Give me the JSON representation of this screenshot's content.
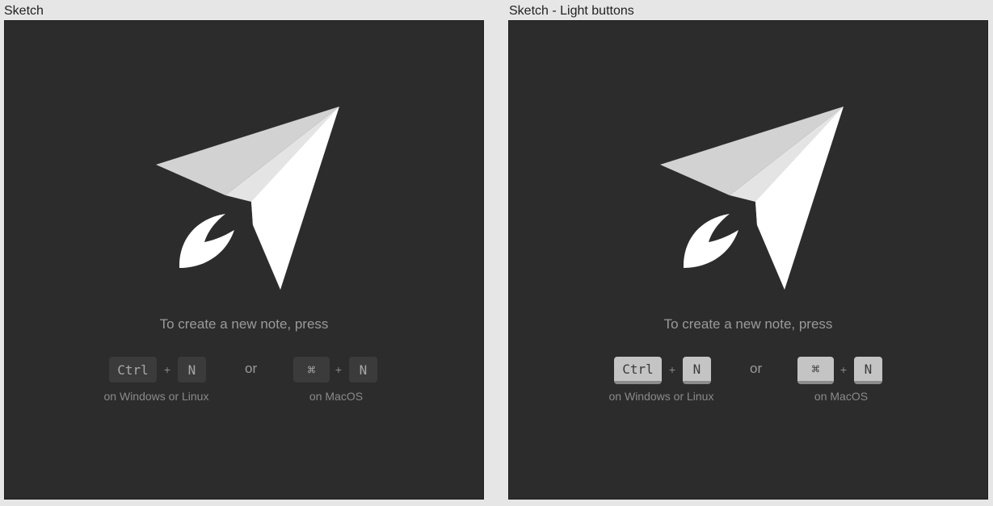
{
  "frames": [
    {
      "title": "Sketch",
      "variant": "dark",
      "prompt": "To create a new note, press",
      "windows": {
        "key1": "Ctrl",
        "plus": "+",
        "key2": "N",
        "caption": "on Windows or Linux"
      },
      "separator": "or",
      "mac": {
        "key1": "⌘",
        "plus": "+",
        "key2": "N",
        "caption": "on MacOS"
      }
    },
    {
      "title": "Sketch - Light buttons",
      "variant": "light",
      "prompt": "To create a new note, press",
      "windows": {
        "key1": "Ctrl",
        "plus": "+",
        "key2": "N",
        "caption": "on Windows or Linux"
      },
      "separator": "or",
      "mac": {
        "key1": "⌘",
        "plus": "+",
        "key2": "N",
        "caption": "on MacOS"
      }
    }
  ],
  "colors": {
    "canvas": "#e6e6e6",
    "panel": "#2c2c2c",
    "logo_light": "#ffffff",
    "logo_mid": "#e4e4e4",
    "logo_shade": "#d2d2d2",
    "text_muted": "#9a9a9a",
    "key_dark": "#3b3b3b",
    "key_light": "#c4c4c4"
  },
  "icons": {
    "logo": "paper-plane-rocket-icon"
  }
}
